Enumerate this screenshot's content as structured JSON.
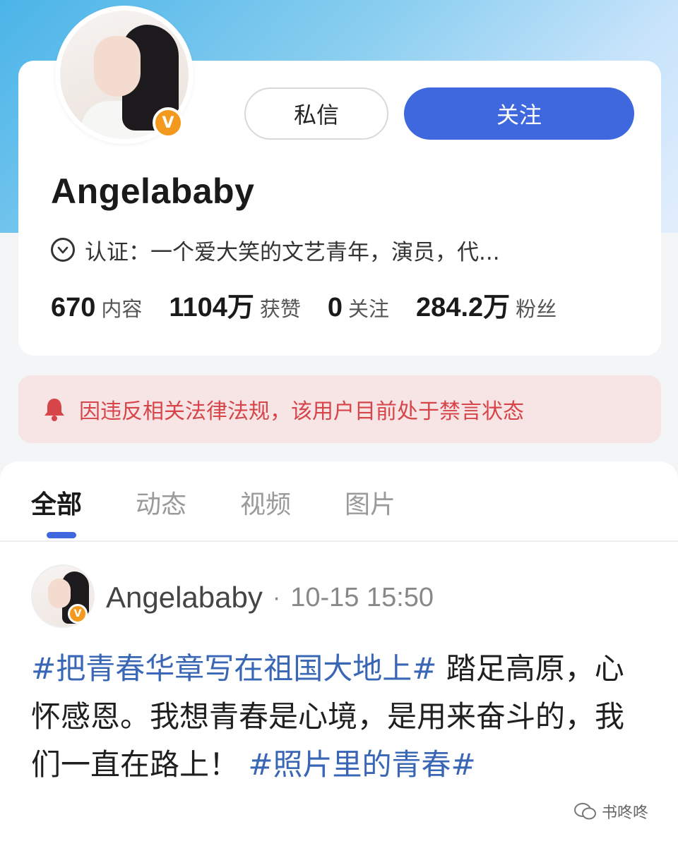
{
  "profile": {
    "username": "Angelababy",
    "badge": "V",
    "buttons": {
      "message": "私信",
      "follow": "关注"
    },
    "verification": "认证：一个爱大笑的文艺青年，演员，代...",
    "stats": [
      {
        "value": "670",
        "label": "内容"
      },
      {
        "value": "1104万",
        "label": "获赞"
      },
      {
        "value": "0",
        "label": "关注"
      },
      {
        "value": "284.2万",
        "label": "粉丝"
      }
    ]
  },
  "alert": {
    "icon": "bell-icon",
    "text": "因违反相关法律法规，该用户目前处于禁言状态",
    "color": "#d6454a"
  },
  "tabs": [
    {
      "label": "全部",
      "active": true
    },
    {
      "label": "动态",
      "active": false
    },
    {
      "label": "视频",
      "active": false
    },
    {
      "label": "图片",
      "active": false
    }
  ],
  "post": {
    "author": "Angelababy",
    "separator": "·",
    "time": "10-15 15:50",
    "badge": "V",
    "hashtag1": "#把青春华章写在祖国大地上#",
    "text": " 踏足高原，心怀感恩。我想青春是心境，是用来奋斗的，我们一直在路上！ ",
    "hashtag2": "#照片里的青春#"
  },
  "watermark": "书咚咚",
  "colors": {
    "accent": "#3f68de",
    "hashtag": "#3a67b5",
    "badge": "#f39a1e"
  }
}
